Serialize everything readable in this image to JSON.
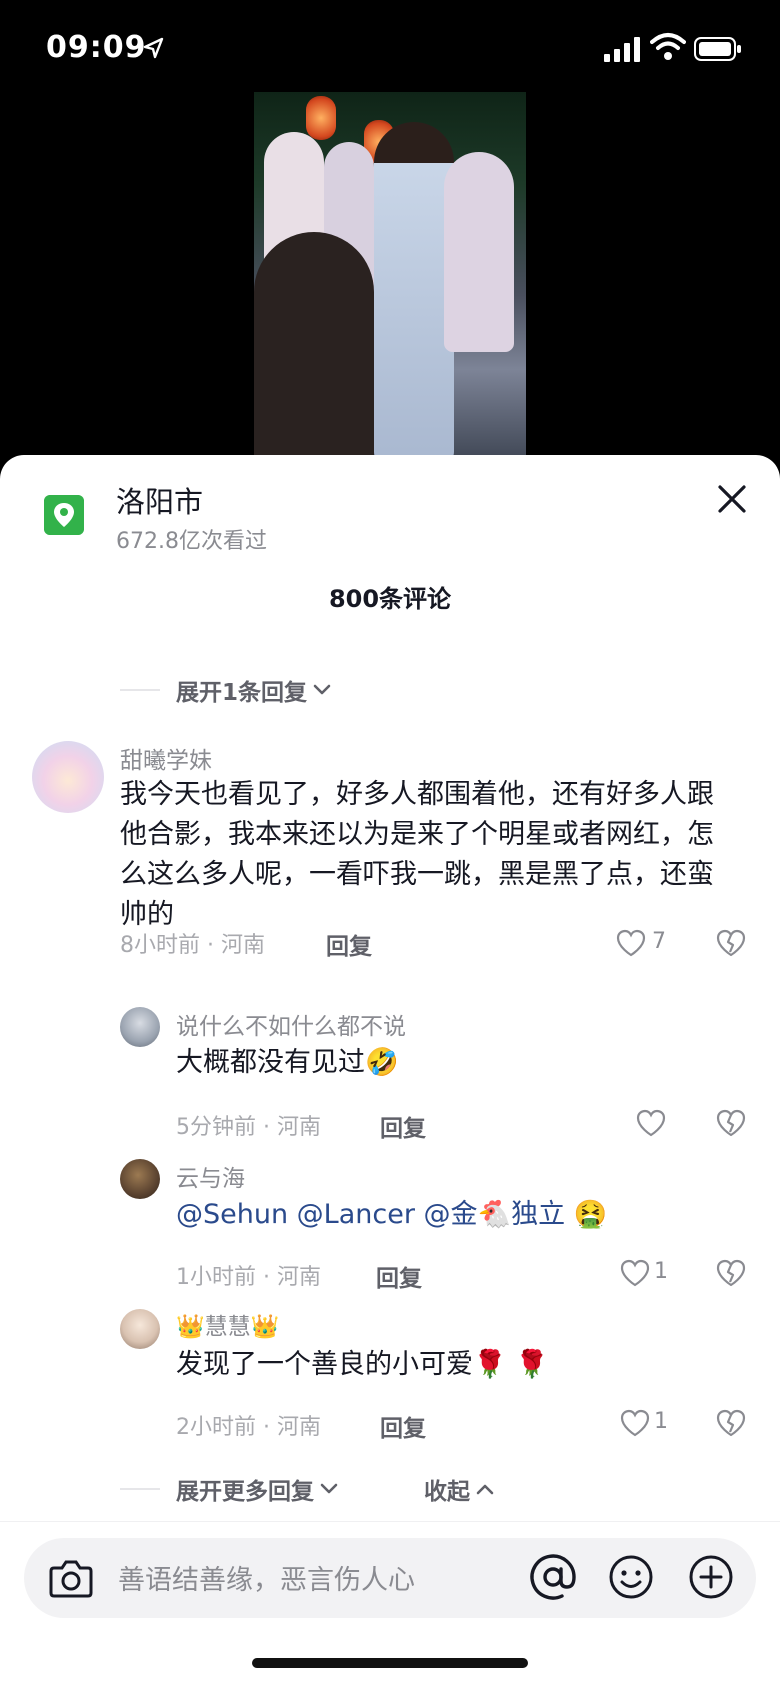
{
  "status_bar": {
    "time": "09:09"
  },
  "location": {
    "name": "洛阳市",
    "views": "672.8亿次看过"
  },
  "comments_header": {
    "count_label": "800条评论"
  },
  "expand_top": {
    "label": "展开1条回复"
  },
  "main_comment": {
    "author": "甜曦学妹",
    "text": "我今天也看见了，好多人都围着他，还有好多人跟他合影，我本来还以为是来了个明星或者网红，怎么这么多人呢，一看吓我一跳，黑是黑了点，还蛮帅的",
    "meta": "8小时前 · 河南",
    "reply_label": "回复",
    "likes": "7"
  },
  "replies": [
    {
      "author": "说什么不如什么都不说",
      "text": "大概都没有见过",
      "emoji": "🤣",
      "meta": "5分钟前 · 河南",
      "reply_label": "回复",
      "likes": ""
    },
    {
      "author": "云与海",
      "text": "@Sehun @Lancer @金",
      "text_tail": "独立",
      "emoji_mid": "🐔",
      "emoji": "🤮",
      "meta": "1小时前 · 河南",
      "reply_label": "回复",
      "likes": "1"
    },
    {
      "author": "慧慧",
      "author_emoji": "👑",
      "text": "发现了一个善良的小可爱",
      "emoji": "🌹 🌹",
      "meta": "2小时前 · 河南",
      "reply_label": "回复",
      "likes": "1"
    }
  ],
  "expand_bottom": {
    "more_label": "展开更多回复",
    "collapse_label": "收起"
  },
  "input": {
    "placeholder": "善语结善缘，恶言伤人心"
  },
  "icons": {
    "location": "map-pin-icon",
    "close": "close-icon",
    "like": "heart-icon",
    "dislike": "broken-heart-icon",
    "camera": "camera-icon",
    "mention": "at-icon",
    "emoji": "smiley-icon",
    "add": "plus-icon"
  },
  "colors": {
    "accent_green": "#32b24a",
    "mention_blue": "#2a4a8c"
  }
}
